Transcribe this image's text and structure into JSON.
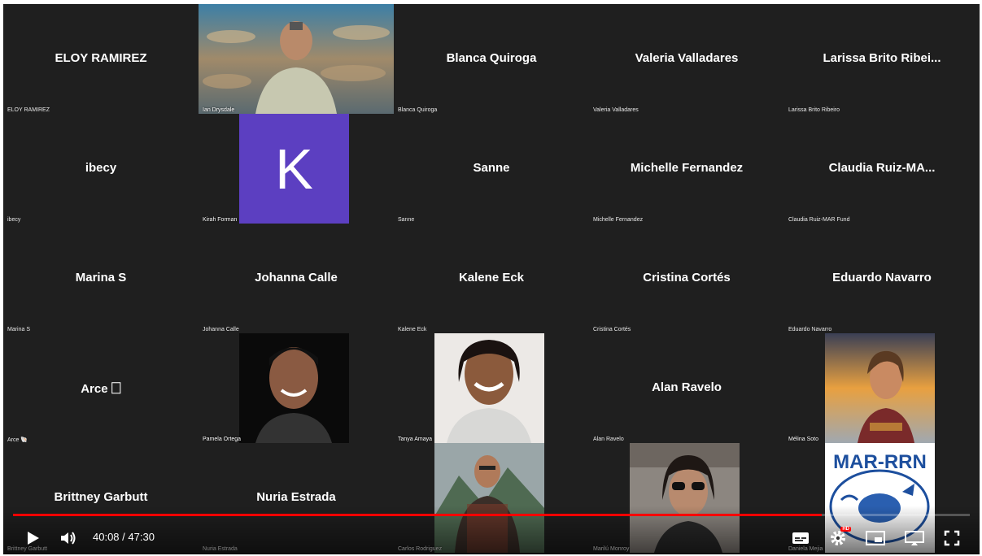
{
  "video": {
    "current_time": "40:08",
    "time_separator": " / ",
    "duration": "47:30",
    "progress_fraction": 0.845,
    "quality_badge": "HD"
  },
  "colors": {
    "tile_bg": "#1f1f1f",
    "progress": "#ff0000",
    "avatar_k": "#5c3fc1"
  },
  "participants": [
    {
      "big": "ELOY RAMIREZ",
      "small": "ELOY RAMIREZ"
    },
    {
      "big": "",
      "small": "Ian Drysdale",
      "video": "ocean"
    },
    {
      "big": "Blanca Quiroga",
      "small": "Blanca Quiroga"
    },
    {
      "big": "Valeria Valladares",
      "small": "Valeria Valladares"
    },
    {
      "big": "Larissa Brito Ribei...",
      "small": "Larissa Brito Ribeiro"
    },
    {
      "big": "ibecy",
      "small": "ibecy"
    },
    {
      "big": "",
      "small": "Kirah Forman",
      "avatar": "K"
    },
    {
      "big": "Sanne",
      "small": "Sanne"
    },
    {
      "big": "Michelle Fernandez",
      "small": "Michelle Fernandez"
    },
    {
      "big": "Claudia Ruiz-MA...",
      "small": "Claudia Ruiz-MAR Fund"
    },
    {
      "big": "Marina S",
      "small": "Marina S"
    },
    {
      "big": "Johanna Calle",
      "small": "Johanna Calle"
    },
    {
      "big": "Kalene Eck",
      "small": "Kalene Eck"
    },
    {
      "big": "Cristina Cortés",
      "small": "Cristina Cortés"
    },
    {
      "big": "Eduardo Navarro",
      "small": "Eduardo Navarro"
    },
    {
      "big": "Arce 🗌",
      "small": "Arce 🐚"
    },
    {
      "big": "",
      "small": "Pamela Ortega",
      "video": "dark"
    },
    {
      "big": "",
      "small": "Tanya Amaya",
      "video": "light"
    },
    {
      "big": "Alan Ravelo",
      "small": "Alan Ravelo"
    },
    {
      "big": "",
      "small": "Mélina Soto",
      "video": "sunset"
    },
    {
      "big": "Brittney Garbutt",
      "small": "Brittney Garbutt"
    },
    {
      "big": "Nuria Estrada",
      "small": "Nuria Estrada"
    },
    {
      "big": "",
      "small": "Carlos Rodriguez",
      "video": "mountain"
    },
    {
      "big": "",
      "small": "Marilú Monroy",
      "video": "car"
    },
    {
      "big": "",
      "small": "Daniela Mejia",
      "video": "logo",
      "logo_text": "MAR-RRN"
    }
  ]
}
